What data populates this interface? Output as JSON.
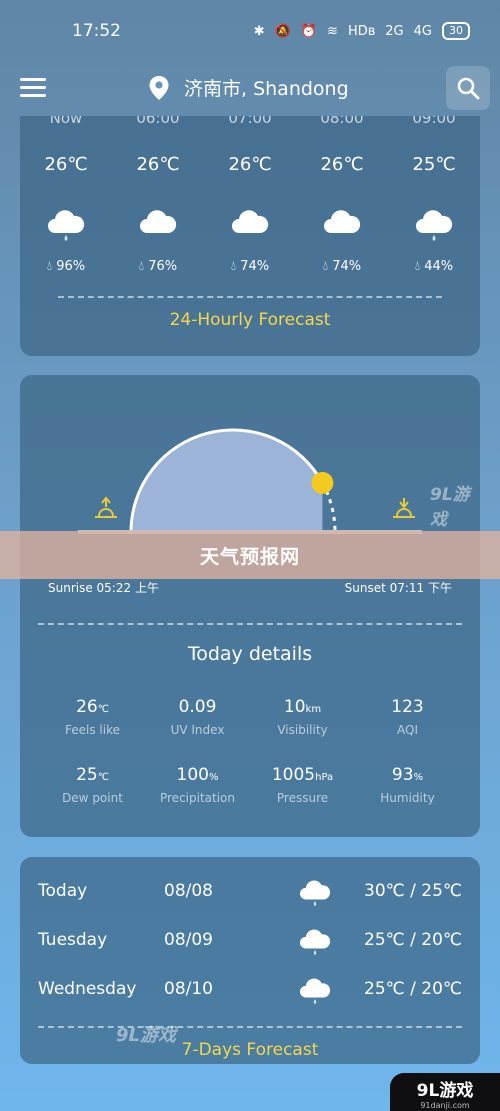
{
  "status": {
    "time": "17:52",
    "net": "HDʙ",
    "sig1": "2G",
    "sig2": "4G",
    "battery": "30"
  },
  "appbar": {
    "location": "济南市, Shandong"
  },
  "hourly": {
    "hours": [
      "Now",
      "06:00",
      "07:00",
      "08:00",
      "09:00"
    ],
    "temps": [
      "26℃",
      "26℃",
      "26℃",
      "26℃",
      "25℃"
    ],
    "humidity": [
      "96%",
      "76%",
      "74%",
      "74%",
      "44%"
    ],
    "icons": [
      "rain-cloud-icon",
      "cloud-icon",
      "cloud-icon",
      "cloud-icon",
      "rain-cloud-icon"
    ],
    "link": "24-Hourly Forecast"
  },
  "sun": {
    "banner": "天气预报网",
    "sunrise": "Sunrise 05:22 上午",
    "sunset": "Sunset 07:11 下午",
    "progress": 0.84
  },
  "details": {
    "title": "Today details",
    "items": [
      {
        "value": "26",
        "unit": "℃",
        "label": "Feels like"
      },
      {
        "value": "0.09",
        "unit": "",
        "label": "UV Index"
      },
      {
        "value": "10",
        "unit": "km",
        "label": "Visibility"
      },
      {
        "value": "123",
        "unit": "",
        "label": "AQI"
      },
      {
        "value": "25",
        "unit": "℃",
        "label": "Dew point"
      },
      {
        "value": "100",
        "unit": "%",
        "label": "Precipitation"
      },
      {
        "value": "1005",
        "unit": "hPa",
        "label": "Pressure"
      },
      {
        "value": "93",
        "unit": "%",
        "label": "Humidity"
      }
    ]
  },
  "daily": {
    "rows": [
      {
        "day": "Today",
        "date": "08/08",
        "range": "30℃ / 25℃",
        "icon": "rain-cloud-icon"
      },
      {
        "day": "Tuesday",
        "date": "08/09",
        "range": "25℃ / 20℃",
        "icon": "rain-cloud-icon"
      },
      {
        "day": "Wednesday",
        "date": "08/10",
        "range": "25℃ / 20℃",
        "icon": "rain-cloud-icon"
      }
    ],
    "link": "7-Days Forecast"
  },
  "watermark": {
    "logo": "9L游戏",
    "corner": "9L游戏",
    "corner_url": "91danji.com"
  },
  "colors": {
    "accent": "#f4d84a",
    "sun": "#f2cb1e",
    "dome": "#9bb4d8"
  }
}
